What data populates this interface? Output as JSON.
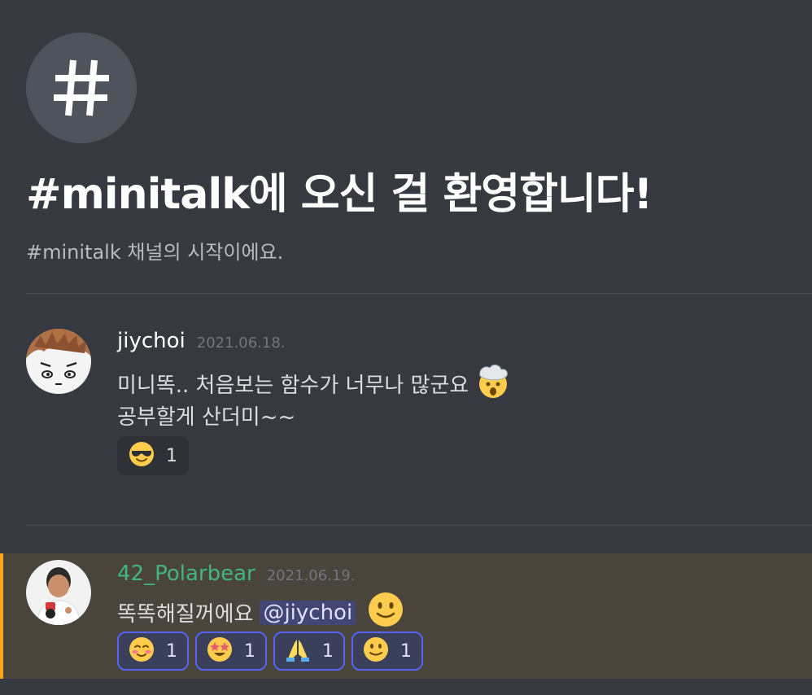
{
  "welcome": {
    "title": "#minitalk에 오신 걸 환영합니다!",
    "subtitle": "#minitalk 채널의 시작이에요."
  },
  "messages": [
    {
      "username": "jiychoi",
      "username_color": "#ffffff",
      "timestamp": "2021.06.18.",
      "lines": [
        "미니똑.. 처음보는 함수가 너무나 많군요",
        "공부할게 산더미~~"
      ],
      "inline_emoji": "exploding-head-emoji",
      "reactions": [
        {
          "emoji": "sunglasses-emoji",
          "count": "1",
          "me": false
        }
      ]
    },
    {
      "username": "42_Polarbear",
      "username_color": "#43b581",
      "timestamp": "2021.06.19.",
      "text": "똑똑해질꺼에요",
      "mention": "@jiychoi",
      "inline_emoji": "slightly-smiling-emoji",
      "highlight_color": "#faa81a",
      "reactions": [
        {
          "emoji": "blush-emoji",
          "count": "1",
          "me": true
        },
        {
          "emoji": "star-struck-emoji",
          "count": "1",
          "me": true
        },
        {
          "emoji": "folded-hands-emoji",
          "count": "1",
          "me": true
        },
        {
          "emoji": "slightly-smiling-emoji",
          "count": "1",
          "me": true
        }
      ]
    }
  ],
  "colors": {
    "background": "#36393f",
    "accent": "#5865f2",
    "mention_bg": "#414675"
  }
}
